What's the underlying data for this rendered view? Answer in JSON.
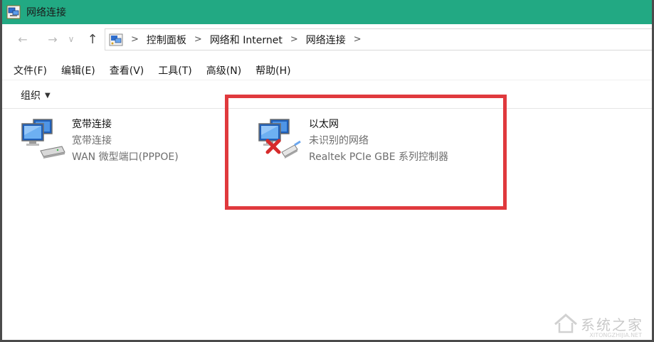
{
  "window": {
    "title": "网络连接"
  },
  "nav": {
    "back_glyph": "←",
    "forward_glyph": "→",
    "recent_glyph": "∨",
    "up_glyph": "↑"
  },
  "breadcrumb": {
    "items": [
      "控制面板",
      "网络和 Internet",
      "网络连接"
    ],
    "separator": ">"
  },
  "menu": {
    "items": [
      "文件(F)",
      "编辑(E)",
      "查看(V)",
      "工具(T)",
      "高级(N)",
      "帮助(H)"
    ]
  },
  "toolbar": {
    "organize_label": "组织",
    "caret": "▼"
  },
  "connections": [
    {
      "name": "宽带连接",
      "status": "宽带连接",
      "device": "WAN 微型端口(PPPOE)",
      "icon": "broadband-connection-icon"
    },
    {
      "name": "以太网",
      "status": "未识别的网络",
      "device": "Realtek PCIe GBE 系列控制器",
      "icon": "ethernet-disconnected-icon"
    }
  ],
  "watermark": {
    "text": "系统之家",
    "sub": "XITONGZHIJIA.NET"
  },
  "colors": {
    "titlebar": "#22a983",
    "highlight": "#e0393d",
    "secondary_text": "#6d6d6d"
  }
}
